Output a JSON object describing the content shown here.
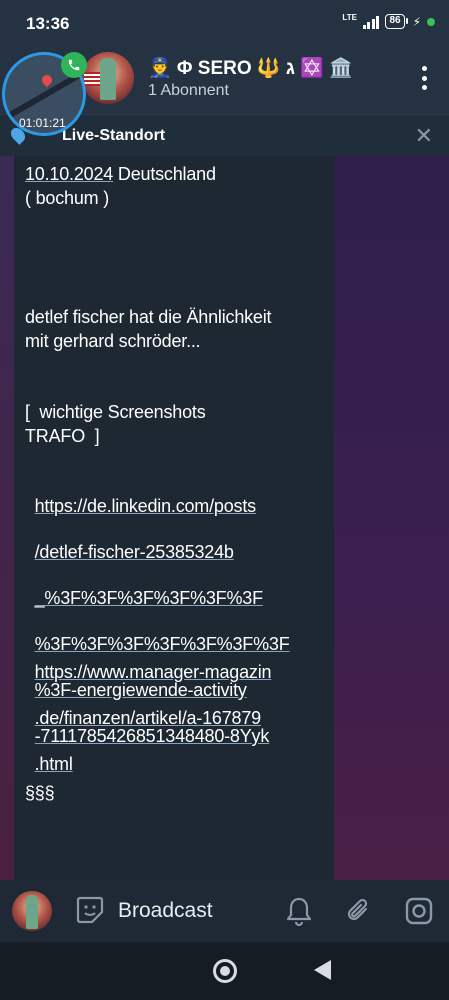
{
  "status": {
    "time": "13:36",
    "network": "LTE",
    "battery": "86"
  },
  "header": {
    "title": "👮 Φ SERO 🔱 ג ✡️ 🏛️",
    "subtitle": "1 Abonnent"
  },
  "pip": {
    "duration": "01:01:21"
  },
  "live_location": {
    "label": "Live-Standort"
  },
  "message": {
    "date": "10.10.2024",
    "line1_rest": " Deutschland",
    "line2": "( bochum )",
    "line3": "detlef fischer hat die Ähnlichkeit",
    "line4": "mit gerhard schröder...",
    "line5": "[  wichtige Screenshots",
    "line6": "TRAFO  ]",
    "link1": [
      "https://de.linkedin.com/posts",
      "/detlef-fischer-25385324b",
      "_%3F%3F%3F%3F%3F%3F",
      "%3F%3F%3F%3F%3F%3F%3F",
      "%3F-energiewende-activity",
      "-7111785426851348480-8Yyk"
    ],
    "link2": [
      "https://www.manager-magazin",
      ".de/finanzen/artikel/a-167879",
      ".html"
    ],
    "footer": "§§§"
  },
  "bottom_bar": {
    "broadcast_label": "Broadcast"
  }
}
